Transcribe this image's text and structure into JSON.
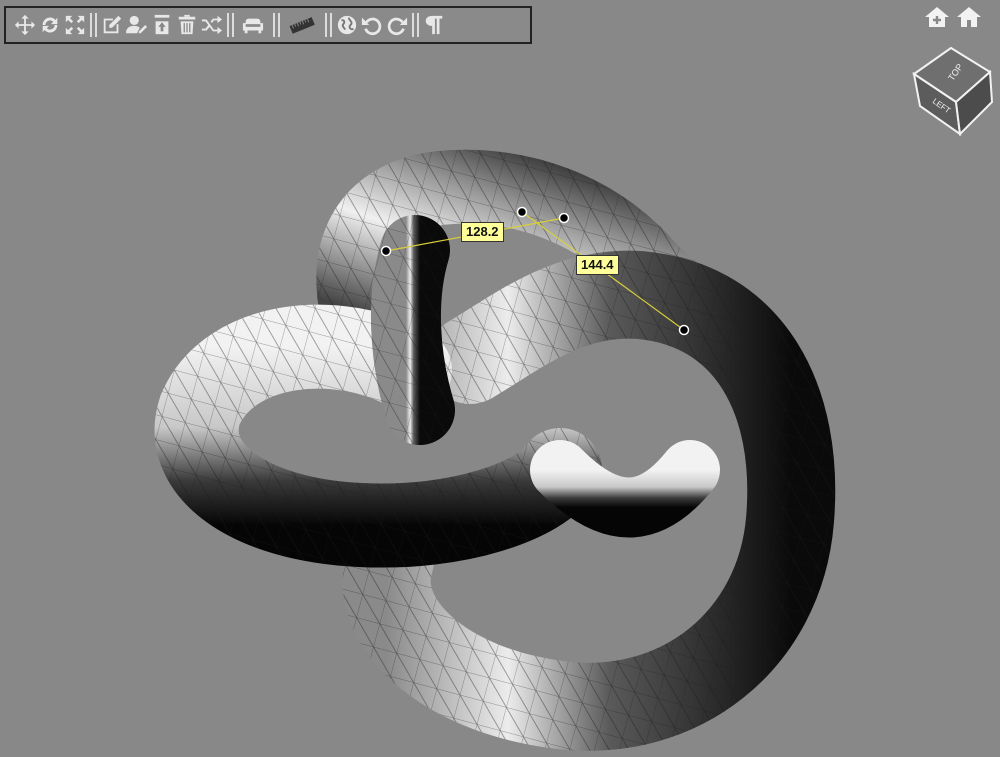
{
  "toolbar": {
    "groups": [
      [
        "move-icon",
        "rotate-icon",
        "scale-icon"
      ],
      [
        "edit-icon",
        "user-edit-icon",
        "upload-icon",
        "delete-icon",
        "shuffle-icon"
      ],
      [
        "sofa-icon"
      ],
      [
        "ruler-icon"
      ],
      [
        "globe-icon",
        "undo-icon",
        "redo-icon"
      ],
      [
        "paragraph-icon"
      ]
    ]
  },
  "home_buttons": [
    "home-plus-icon",
    "home-icon"
  ],
  "view_cube": {
    "top_label": "TOP",
    "left_label": "LEFT"
  },
  "measurements": [
    {
      "value": "128.2"
    },
    {
      "value": "144.4"
    }
  ],
  "colors": {
    "background": "#888888",
    "label_bg": "#ffff99",
    "measure_line": "#d8cf3a"
  }
}
